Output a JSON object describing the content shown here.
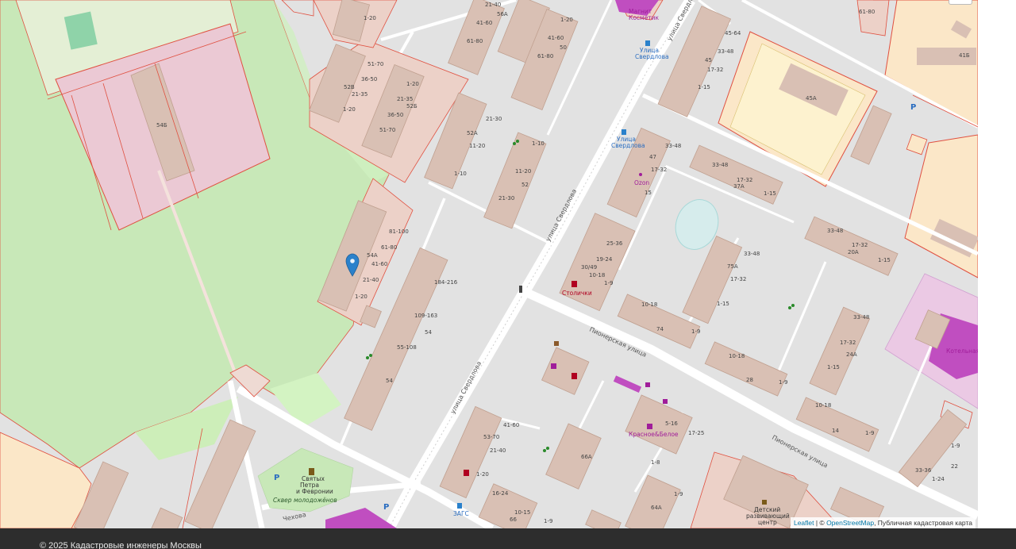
{
  "map": {
    "colors": {
      "background": "#e2e2e2",
      "park": "#c8e8b8",
      "building": "#d9c0b4",
      "building_outline": "#c0a090",
      "parcel": "#e05040",
      "pink_area": "#ebc9d4",
      "yellow_area": "#fbe7c8",
      "road": "#ffffff",
      "magenta": "#c04ec0",
      "pin": "#2a81cb"
    },
    "streets": [
      {
        "name": "улица Свердлова"
      },
      {
        "name": "улица Свердлова"
      },
      {
        "name": "улица Свердлова"
      },
      {
        "name": "Пионерская улица"
      },
      {
        "name": "Пионерская улица"
      },
      {
        "name": "Чехова"
      }
    ],
    "pois": [
      {
        "name": "Магнит Косметик",
        "icon": "shop-icon"
      },
      {
        "name": "Улица Свердлова",
        "icon": "bus-stop-icon"
      },
      {
        "name": "Улица Свердлова",
        "icon": "bus-stop-icon"
      },
      {
        "name": "Ozon",
        "icon": "pickup-point-icon"
      },
      {
        "name": "Столички",
        "icon": "liquor-store-icon"
      },
      {
        "name": "Красное&Белое",
        "icon": "liquor-store-icon"
      },
      {
        "name": "Святых Петра и Февронии",
        "icon": "church-icon"
      },
      {
        "name": "Сквер молодожёнов",
        "icon": "park-icon"
      },
      {
        "name": "ЗАГС",
        "icon": "bus-stop-icon"
      },
      {
        "name": "Детский развивающий центр",
        "icon": "school-icon"
      },
      {
        "name": "Котельная",
        "icon": "building-icon"
      }
    ],
    "building_numbers": [
      "1-20",
      "56А",
      "41-60",
      "61-80",
      "1-20",
      "21-40",
      "41-60",
      "61-80",
      "50",
      "51-70",
      "36-50",
      "52В",
      "21-35",
      "1-20",
      "1-20",
      "21-35",
      "52Б",
      "36-50",
      "51-70",
      "54Б",
      "52А",
      "11-20",
      "1-10",
      "1-10",
      "21-30",
      "52",
      "11-20",
      "21-30",
      "81-100",
      "61-80",
      "54А",
      "41-60",
      "21-40",
      "1-20",
      "184-216",
      "109-163",
      "54",
      "55-108",
      "54",
      "53-70",
      "21-40",
      "41-60",
      "1-20",
      "16-24",
      "10-15",
      "66",
      "1-9",
      "45-64",
      "45",
      "33-48",
      "17-32",
      "1-15",
      "45А",
      "61-80",
      "41Б",
      "47",
      "33-48",
      "17-32",
      "Ozon",
      "15",
      "33-48",
      "17-32",
      "37А",
      "1-15",
      "33-48",
      "17-32",
      "20А",
      "1-15",
      "25-36",
      "19-24",
      "30/49",
      "10-18",
      "1-9",
      "75А",
      "33-48",
      "17-32",
      "1-15",
      "10-18",
      "74",
      "1-9",
      "5-16",
      "17-25",
      "64А",
      "1-9",
      "10-18",
      "28",
      "1-9",
      "33-48",
      "17-32",
      "24А",
      "1-15",
      "10-18",
      "14",
      "1-9",
      "33-36",
      "1-24",
      "22",
      "1-9",
      "66А",
      "1-8"
    ],
    "parking_label": "P",
    "marker": {
      "name": "selected-location-pin"
    }
  },
  "attribution": {
    "leaflet": "Leaflet",
    "sep": " | © ",
    "osm": "OpenStreetMap",
    "rest": ", Публичная кадастровая карта"
  },
  "footer": {
    "text": "© 2025 Кадастровые инженеры Москвы"
  }
}
